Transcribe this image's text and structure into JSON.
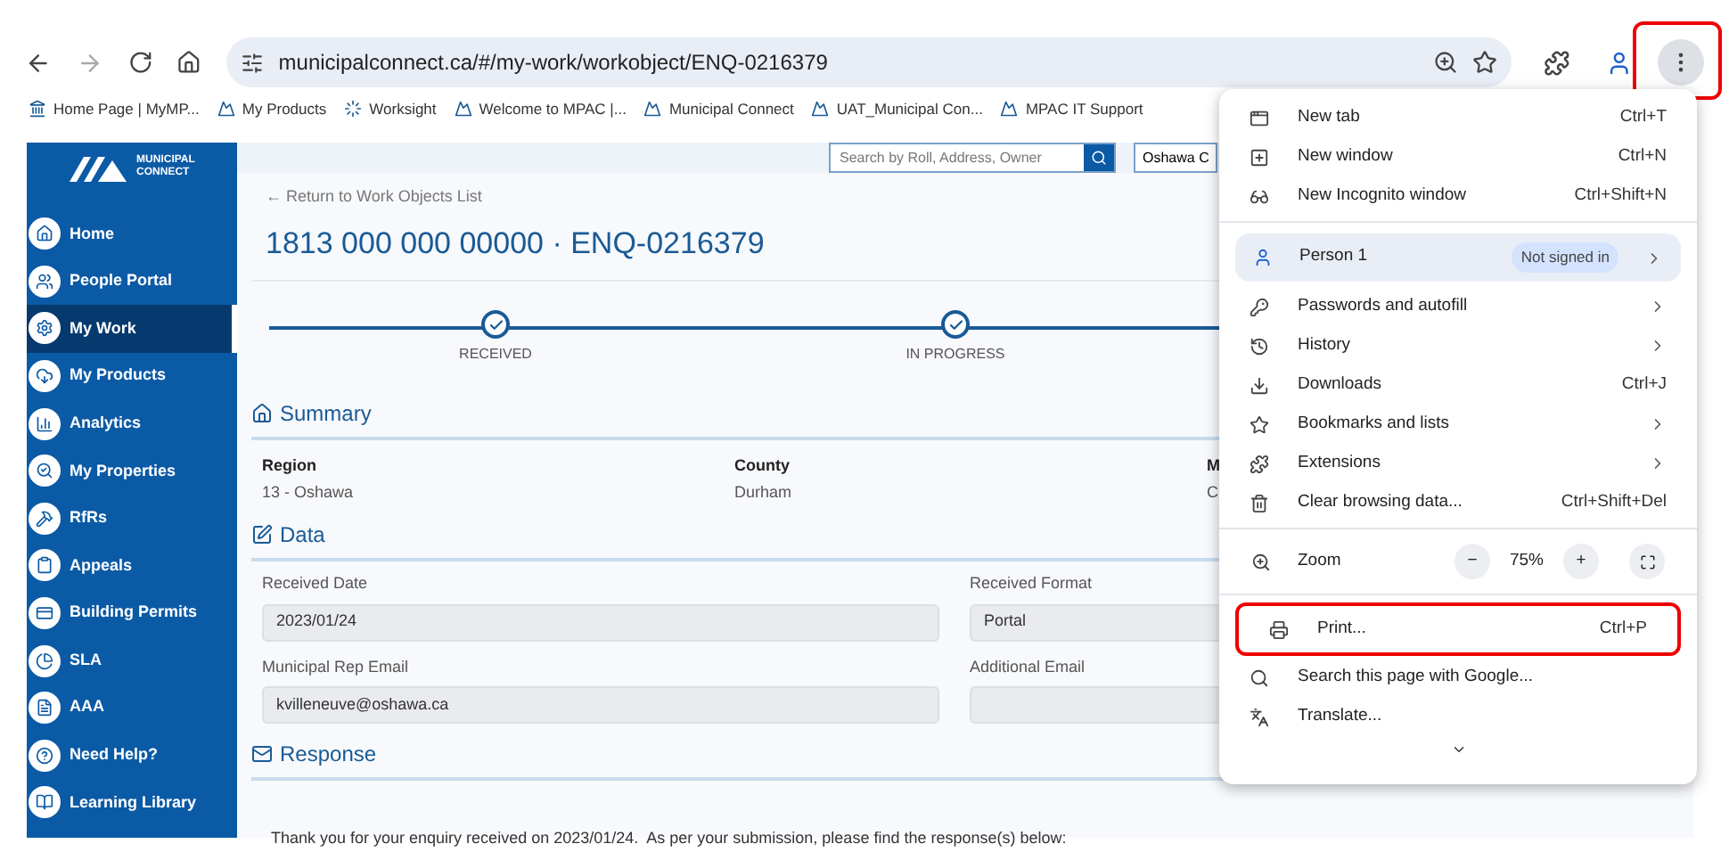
{
  "browser": {
    "url": "municipalconnect.ca/#/my-work/workobject/ENQ-0216379",
    "menu_button_highlighted": true,
    "bookmarks": [
      {
        "label": "Home Page | MyMP..."
      },
      {
        "label": "My Products"
      },
      {
        "label": "Worksight"
      },
      {
        "label": "Welcome to MPAC |..."
      },
      {
        "label": "Municipal Connect"
      },
      {
        "label": "UAT_Municipal Con..."
      },
      {
        "label": "MPAC IT Support"
      }
    ]
  },
  "sidebar": {
    "logo_lines": [
      "MUNICIPAL",
      "CONNECT"
    ],
    "items": [
      {
        "label": "Home",
        "selected": false
      },
      {
        "label": "People Portal",
        "selected": false
      },
      {
        "label": "My Work",
        "selected": true
      },
      {
        "label": "My Products",
        "selected": false
      },
      {
        "label": "Analytics",
        "selected": false
      },
      {
        "label": "My Properties",
        "selected": false
      },
      {
        "label": "RfRs",
        "selected": false
      },
      {
        "label": "Appeals",
        "selected": false
      },
      {
        "label": "Building Permits",
        "selected": false
      },
      {
        "label": "SLA",
        "selected": false
      },
      {
        "label": "AAA",
        "selected": false
      },
      {
        "label": "Need Help?",
        "selected": false
      },
      {
        "label": "Learning Library",
        "selected": false
      }
    ]
  },
  "header": {
    "search_placeholder": "Search by Roll, Address, Owner",
    "municipality": "Oshawa C"
  },
  "back_link": "← Return to Work Objects List",
  "title": "1813 000 000 00000 · ENQ-0216379",
  "steps": [
    {
      "label": "RECEIVED",
      "done": true
    },
    {
      "label": "IN PROGRESS",
      "done": true
    }
  ],
  "summary": {
    "title": "Summary",
    "fields": [
      {
        "label": "Region",
        "value": "13 - Oshawa"
      },
      {
        "label": "County",
        "value": "Durham"
      },
      {
        "label": "M",
        "value": "C"
      }
    ]
  },
  "data": {
    "title": "Data",
    "fields": [
      {
        "label": "Received Date",
        "value": "2023/01/24"
      },
      {
        "label": "Received Format",
        "value": "Portal"
      },
      {
        "label": "Municipal Rep Email",
        "value": "kvilleneuve@oshawa.ca"
      },
      {
        "label": "Additional Email"
      }
    ]
  },
  "response": {
    "title": "Response",
    "text": "Thank you for your enquiry received on 2023/01/24.  As per your submission, please find the response(s) below:"
  },
  "menu": {
    "groups": [
      [
        {
          "kind": "item",
          "label": "New tab",
          "shortcut": "Ctrl+T",
          "submenu": false,
          "highlighted": false
        },
        {
          "kind": "item",
          "label": "New window",
          "shortcut": "Ctrl+N",
          "submenu": false,
          "highlighted": false
        },
        {
          "kind": "item",
          "label": "New Incognito window",
          "shortcut": "Ctrl+Shift+N",
          "submenu": false,
          "highlighted": false
        }
      ],
      [
        {
          "kind": "profile",
          "label": "Person 1",
          "badge": "Not signed in",
          "submenu": true
        },
        {
          "kind": "item",
          "label": "Passwords and autofill",
          "submenu": true,
          "highlighted": false
        },
        {
          "kind": "item",
          "label": "History",
          "submenu": true,
          "highlighted": false
        },
        {
          "kind": "item",
          "label": "Downloads",
          "shortcut": "Ctrl+J",
          "submenu": false,
          "highlighted": false
        },
        {
          "kind": "item",
          "label": "Bookmarks and lists",
          "submenu": true,
          "highlighted": false
        },
        {
          "kind": "item",
          "label": "Extensions",
          "submenu": true,
          "highlighted": false
        },
        {
          "kind": "item",
          "label": "Clear browsing data...",
          "shortcut": "Ctrl+Shift+Del",
          "submenu": false,
          "highlighted": false
        }
      ],
      [
        {
          "kind": "zoom",
          "label": "Zoom",
          "minus": "−",
          "value": "75%",
          "plus": "+"
        }
      ],
      [
        {
          "kind": "item",
          "label": "Print...",
          "shortcut": "Ctrl+P",
          "submenu": false,
          "highlighted": true
        },
        {
          "kind": "item",
          "label": "Search this page with Google...",
          "submenu": false,
          "highlighted": false
        },
        {
          "kind": "item",
          "label": "Translate...",
          "submenu": false,
          "highlighted": false
        }
      ]
    ]
  }
}
